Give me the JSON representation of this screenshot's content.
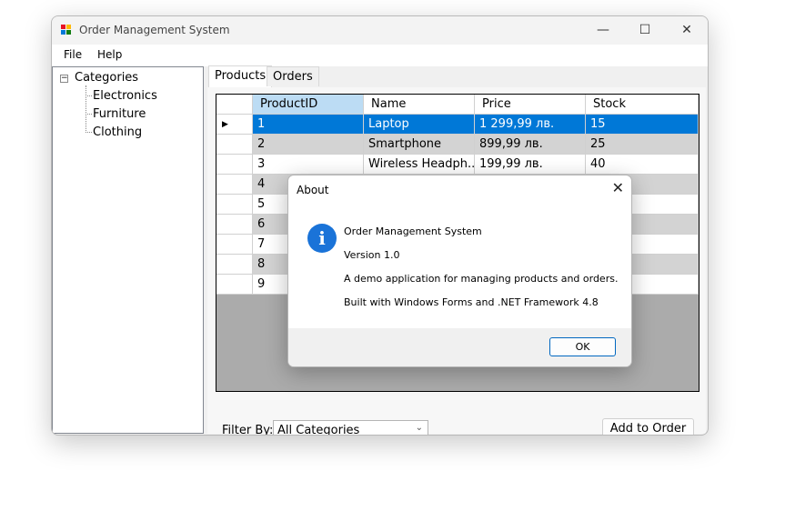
{
  "window": {
    "title": "Order Management System",
    "controls": {
      "minimize": "—",
      "maximize": "☐",
      "close": "✕"
    }
  },
  "menu": {
    "file": "File",
    "help": "Help"
  },
  "tree": {
    "root": "Categories",
    "expander": "−",
    "children": [
      "Electronics",
      "Furniture",
      "Clothing"
    ]
  },
  "tabs": [
    "Products",
    "Orders"
  ],
  "grid": {
    "columns": [
      "ProductID",
      "Name",
      "Price",
      "Stock"
    ],
    "rows": [
      [
        "1",
        "Laptop",
        "1 299,99 лв.",
        "15"
      ],
      [
        "2",
        "Smartphone",
        "899,99 лв.",
        "25"
      ],
      [
        "3",
        "Wireless Headph...",
        "199,99 лв.",
        "40"
      ],
      [
        "4",
        "",
        "",
        ""
      ],
      [
        "5",
        "",
        "",
        ""
      ],
      [
        "6",
        "",
        "",
        ""
      ],
      [
        "7",
        "",
        "",
        ""
      ],
      [
        "8",
        "",
        "",
        ""
      ],
      [
        "9",
        "",
        "",
        ""
      ]
    ],
    "selected_row_indicator": "▶"
  },
  "filter": {
    "label": "Filter By:",
    "value": "All Categories",
    "arrow": "⌄"
  },
  "add_button": "Add to Order",
  "dialog": {
    "title": "About",
    "close": "✕",
    "icon": "i",
    "lines": [
      "Order Management System",
      "Version 1.0",
      "A demo application for managing products and orders.",
      "Built with Windows Forms and .NET Framework 4.8"
    ],
    "ok": "OK"
  },
  "colors": {
    "selection": "#0078d7",
    "header_selected": "#bcdcf4",
    "alt_row": "#d3d3d3",
    "info_icon": "#1a73d8"
  }
}
